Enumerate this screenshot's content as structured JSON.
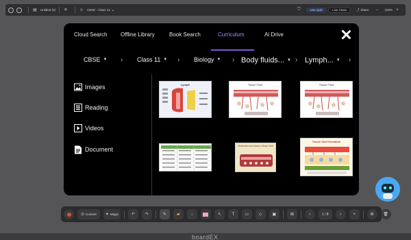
{
  "topbar": {
    "doc_title": "Untitled (0)",
    "class_selector": "CBSE - Class 12",
    "btn_live_quiz": "Live Quiz",
    "btn_live_class": "Live Class",
    "btn_share": "Share",
    "zoom": "100%"
  },
  "modal": {
    "tabs": [
      "Cloud Search",
      "Offline Library",
      "Book Search",
      "Curriculum",
      "Ai Drive"
    ],
    "active_tab": "Curriculum",
    "breadcrumbs": [
      "CBSE",
      "Class 11",
      "Biology",
      "Body fluids...",
      "Lymph..."
    ],
    "sidebar": [
      "Images",
      "Reading",
      "Videos",
      "Document"
    ],
    "thumbnails": [
      {
        "title": "Lymph"
      },
      {
        "title": "Tissue Fluid"
      },
      {
        "title": "Tissue Fluid"
      },
      {
        "title": ""
      },
      {
        "title": "Mechanism and status of tissue fluid"
      },
      {
        "title": "Tissue fluid formation"
      }
    ]
  },
  "bottombar": {
    "content_label": "Content",
    "magic_label": "Magic",
    "page_counter": "1 / 8"
  },
  "brand": "boardEX",
  "colors": {
    "accent": "#a78bfa",
    "modal_bg": "#000000",
    "canvas_bg": "#555557"
  }
}
